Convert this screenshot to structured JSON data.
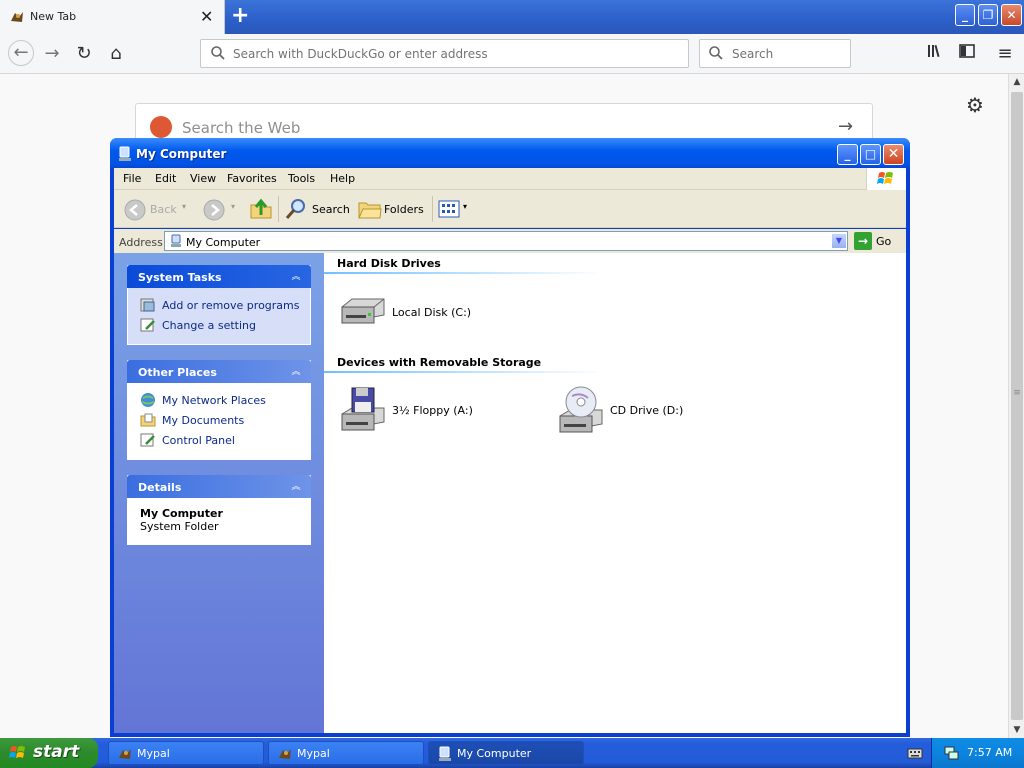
{
  "firefox": {
    "tab_title": "New Tab",
    "urlbar_placeholder": "Search with DuckDuckGo or enter address",
    "searchbar_placeholder": "Search",
    "newtab_search_placeholder": "Search the Web"
  },
  "window": {
    "title": "My Computer",
    "menu": [
      "File",
      "Edit",
      "View",
      "Favorites",
      "Tools",
      "Help"
    ],
    "toolbar": {
      "back": "Back",
      "search": "Search",
      "folders": "Folders"
    },
    "address": {
      "label": "Address",
      "value": "My Computer",
      "go": "Go"
    },
    "panels": {
      "system_tasks": {
        "title": "System Tasks",
        "links": [
          "Add or remove programs",
          "Change a setting"
        ]
      },
      "other_places": {
        "title": "Other Places",
        "links": [
          "My Network Places",
          "My Documents",
          "Control Panel"
        ]
      },
      "details": {
        "title": "Details",
        "name": "My Computer",
        "type": "System Folder"
      }
    },
    "groups": {
      "hard_disks": {
        "title": "Hard Disk Drives",
        "drives": [
          "Local Disk (C:)"
        ]
      },
      "removable": {
        "title": "Devices with Removable Storage",
        "drives": [
          "3½ Floppy (A:)",
          "CD Drive (D:)"
        ]
      }
    }
  },
  "taskbar": {
    "start": "start",
    "items": [
      "Mypal",
      "Mypal",
      "My Computer"
    ],
    "active_item": 2,
    "clock": "7:57 AM"
  },
  "colors": {
    "xp_blue": "#0a3fd2",
    "start_green": "#2d8b2d",
    "ddg_orange": "#de5833"
  }
}
